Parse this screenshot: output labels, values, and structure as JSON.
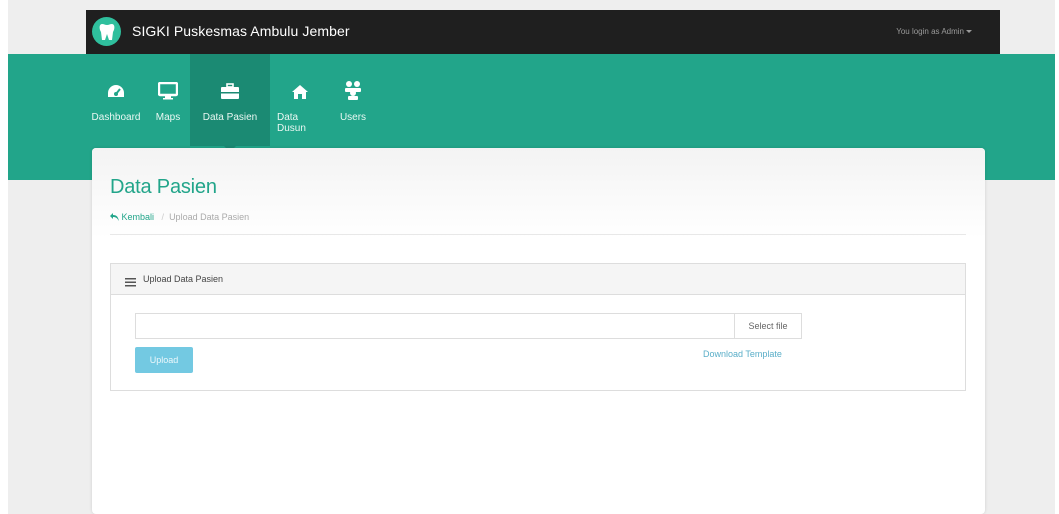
{
  "brand": {
    "title": "SIGKI Puskesmas Ambulu Jember"
  },
  "user_menu": {
    "label": "You login as Admin"
  },
  "nav": [
    {
      "label": "Dashboard",
      "icon": "dashboard-icon"
    },
    {
      "label": "Maps",
      "icon": "monitor-icon"
    },
    {
      "label": "Data Pasien",
      "icon": "briefcase-icon",
      "active": true
    },
    {
      "label": "Data Dusun",
      "icon": "home-icon"
    },
    {
      "label": "Users",
      "icon": "users-icon"
    }
  ],
  "page": {
    "title": "Data Pasien",
    "breadcrumb_back": "Kembali",
    "breadcrumb_current": "Upload Data Pasien"
  },
  "panel": {
    "title": "Upload Data Pasien",
    "file_value": "",
    "select_file_label": "Select file",
    "upload_label": "Upload",
    "download_label": "Download Template"
  },
  "colors": {
    "accent": "#22a58a",
    "topbar": "#1f1f1f",
    "nav_active": "#1b8a73",
    "upload_button": "#5bc0de"
  }
}
